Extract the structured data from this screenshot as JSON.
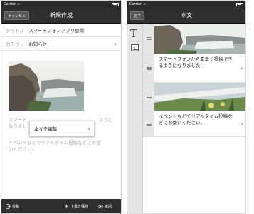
{
  "left": {
    "status": {
      "carrier": "Carrier"
    },
    "navbar": {
      "cancel_label": "キャンセル",
      "title": "新規作成"
    },
    "fields": [
      {
        "label": "タイトル :",
        "value": "スマートフォンアプリ登場!"
      },
      {
        "label": "カテゴリ :",
        "value": "お知らせ"
      }
    ],
    "body_text": {
      "line1_start": "スマート",
      "line1_end": "ように",
      "line2_start": "なりまし",
      "line3": "イベントなどでリアルタイム投稿などにお使",
      "line4": "いください。"
    },
    "popover": {
      "label": "本文を編集"
    },
    "bottom_bar": {
      "post_label": "投稿",
      "draft_label": "下書き保存",
      "preview_label": "確認"
    }
  },
  "right": {
    "status": {
      "carrier": "Carrier"
    },
    "navbar": {
      "done_label": "完了",
      "title": "本文"
    },
    "sidebar": {
      "text_tool": "T"
    },
    "blocks": [
      {
        "text": ""
      },
      {
        "text": "スマートフォンから素早く投稿できるようになりました!"
      },
      {
        "text": ""
      },
      {
        "text": "イベントなどでリアルタイム投稿などにお使いください。"
      }
    ]
  },
  "colors": {
    "bar": "#2f2f2f",
    "handle": "#e6e6e6"
  },
  "icons": [
    "chevron-right-icon",
    "text-tool-icon",
    "image-tool-icon",
    "drag-handle-icon",
    "post-icon",
    "download-icon",
    "eye-icon",
    "wifi-icon",
    "battery-icon"
  ]
}
